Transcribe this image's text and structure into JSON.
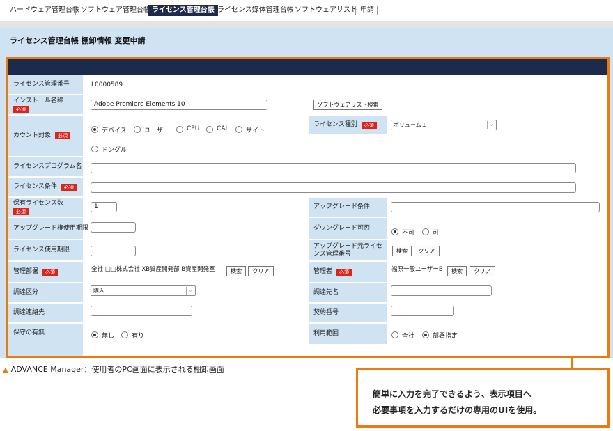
{
  "nav": {
    "items": [
      "ハードウェア管理台帳",
      "ソフトウェア管理台帳",
      "ライセンス管理台帳",
      "ライセンス媒体管理台帳",
      "ソフトウェアリスト",
      "申請"
    ],
    "active": "ライセンス管理台帳"
  },
  "page_title": "ライセンス管理台帳 棚卸情報 変更申請",
  "required_badge": "必須",
  "fields": {
    "license_no_label": "ライセンス管理番号",
    "license_no_value": "L0000589",
    "install_name_label": "インストール名称",
    "install_name_value": "Adobe Premiere Elements 10",
    "software_list_search_btn": "ソフトウェアリスト検索",
    "count_target_label": "カウント対象",
    "count_options": [
      "デバイス",
      "ユーザー",
      "CPU",
      "CAL",
      "サイト",
      "ドングル"
    ],
    "count_selected": "デバイス",
    "license_type_label": "ライセンス種別",
    "license_type_value": "ボリューム１",
    "program_name_label": "ライセンスプログラム名",
    "license_condition_label": "ライセンス条件",
    "owned_count_label": "保有ライセンス数",
    "owned_count_value": "1",
    "upgrade_condition_label": "アップグレード条件",
    "upgrade_right_period_label": "アップグレード権使用期限",
    "downgrade_label": "ダウングレード可否",
    "downgrade_options": [
      "不可",
      "可"
    ],
    "downgrade_selected": "不可",
    "license_period_label": "ライセンス使用期限",
    "upgrade_source_label": "アップグレード元ライセンス管理番号",
    "search_btn": "検索",
    "clear_btn": "クリア",
    "dept_label": "管理部署",
    "dept_value": "全社 □□株式会社 XB資産開発部 B資産開発室",
    "manager_label": "管理者",
    "manager_value": "福原一般ユーザーB",
    "procurement_type_label": "調達区分",
    "procurement_type_value": "購入",
    "supplier_label": "調達先名",
    "supplier_contact_label": "調達連絡先",
    "contract_no_label": "契約番号",
    "maintenance_label": "保守の有無",
    "maintenance_options": [
      "無し",
      "有り"
    ],
    "maintenance_selected": "無し",
    "usage_scope_label": "利用範囲",
    "usage_scope_options": [
      "全社",
      "部署指定"
    ],
    "usage_scope_selected": "部署指定"
  },
  "caption": "ADVANCE Manager：使用者のPC画面に表示される棚卸画面",
  "callout": {
    "line1": "簡単に入力を完了できるよう、表示項目へ",
    "line2": "必要事項を入力するだけの専用のUIを使用。"
  },
  "colors": {
    "accent_orange": "#ec7a10",
    "navy": "#1c2a4c",
    "label_bg": "#cfe3f2",
    "required_red": "#d9251c"
  }
}
